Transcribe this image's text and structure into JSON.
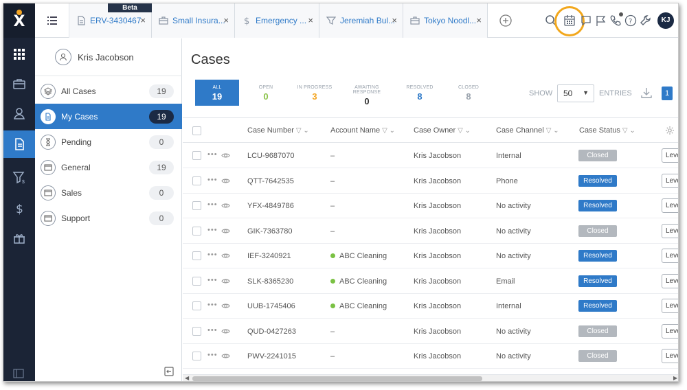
{
  "rail": {
    "logo": "X",
    "items": [
      "apps-grid",
      "briefcase",
      "contacts",
      "cases",
      "funnel-dollar",
      "dollar",
      "gift"
    ]
  },
  "tabs": [
    {
      "label": "ERV-3430467",
      "icon": "document-icon"
    },
    {
      "label": "Small Insura...",
      "icon": "briefcase-icon"
    },
    {
      "label": "Emergency ...",
      "icon": "dollar-icon"
    },
    {
      "label": "Jeremiah Bul...",
      "icon": "funnel-icon"
    },
    {
      "label": "Tokyo Noodl...",
      "icon": "briefcase-icon"
    }
  ],
  "beta_label": "Beta",
  "close_glyph": "×",
  "user": {
    "initials": "KJ",
    "name": "Kris Jacobson"
  },
  "folders": [
    {
      "label": "All Cases",
      "count": "19"
    },
    {
      "label": "My Cases",
      "count": "19"
    },
    {
      "label": "Pending",
      "count": "0"
    },
    {
      "label": "General",
      "count": "19"
    },
    {
      "label": "Sales",
      "count": "0"
    },
    {
      "label": "Support",
      "count": "0"
    }
  ],
  "page_title": "Cases",
  "status_cards": [
    {
      "label": "ALL",
      "value": "19",
      "color": "#ffffff"
    },
    {
      "label": "OPEN",
      "value": "0",
      "color": "#8bc34a"
    },
    {
      "label": "IN PROGRESS",
      "value": "3",
      "color": "#f5a623"
    },
    {
      "label": "AWAITING RESPONSE",
      "value": "0",
      "color": "#333333"
    },
    {
      "label": "RESOLVED",
      "value": "8",
      "color": "#2f7ac8"
    },
    {
      "label": "CLOSED",
      "value": "8",
      "color": "#9aa3ad"
    }
  ],
  "entries": {
    "show_label": "SHOW",
    "value": "50",
    "entries_label": "ENTRIES",
    "page": "1"
  },
  "columns": [
    "Case Number",
    "Account Name",
    "Case Owner",
    "Case Channel",
    "Case Status"
  ],
  "rows": [
    {
      "case_number": "LCU-9687070",
      "account": "–",
      "owner": "Kris Jacobson",
      "channel": "Internal",
      "status": "Closed"
    },
    {
      "case_number": "QTT-7642535",
      "account": "–",
      "owner": "Kris Jacobson",
      "channel": "Phone",
      "status": "Resolved"
    },
    {
      "case_number": "YFX-4849786",
      "account": "–",
      "owner": "Kris Jacobson",
      "channel": "No activity",
      "status": "Resolved"
    },
    {
      "case_number": "GIK-7363780",
      "account": "–",
      "owner": "Kris Jacobson",
      "channel": "No activity",
      "status": "Closed"
    },
    {
      "case_number": "IEF-3240921",
      "account": "ABC Cleaning",
      "owner": "Kris Jacobson",
      "channel": "No activity",
      "status": "Resolved"
    },
    {
      "case_number": "SLK-8365230",
      "account": "ABC Cleaning",
      "owner": "Kris Jacobson",
      "channel": "Email",
      "status": "Resolved"
    },
    {
      "case_number": "UUB-1745406",
      "account": "ABC Cleaning",
      "owner": "Kris Jacobson",
      "channel": "Internal",
      "status": "Resolved"
    },
    {
      "case_number": "QUD-0427263",
      "account": "–",
      "owner": "Kris Jacobson",
      "channel": "No activity",
      "status": "Closed"
    },
    {
      "case_number": "PWV-2241015",
      "account": "–",
      "owner": "Kris Jacobson",
      "channel": "No activity",
      "status": "Closed"
    }
  ],
  "level_label": "Leve",
  "status_colors": {
    "Closed": "#b3b8be",
    "Resolved": "#2f7ac8"
  }
}
